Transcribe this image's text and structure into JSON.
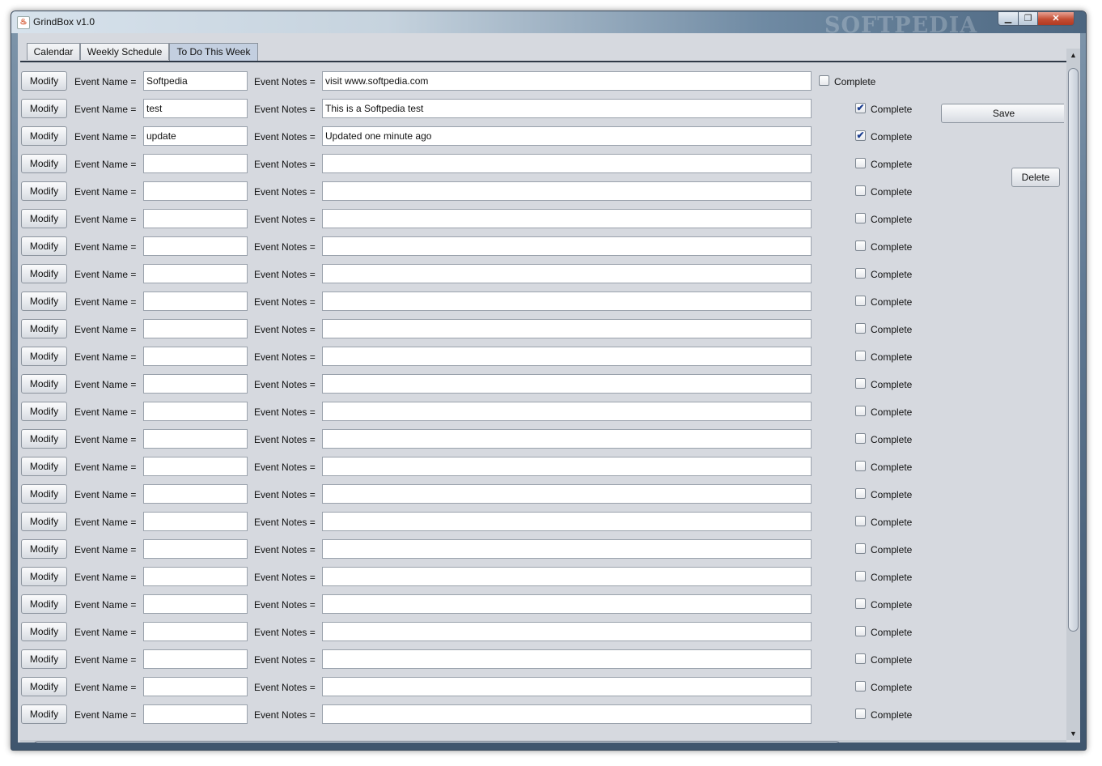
{
  "window": {
    "title": "GrindBox v1.0",
    "watermark": "SOFTPEDIA",
    "controls": {
      "minimize": "▁",
      "maximize": "❐",
      "close": "✕"
    }
  },
  "tabs": [
    {
      "label": "Calendar",
      "active": false
    },
    {
      "label": "Weekly Schedule",
      "active": false
    },
    {
      "label": "To Do This Week",
      "active": true
    }
  ],
  "labels": {
    "modify": "Modify",
    "event_name": "Event Name =",
    "event_notes": "Event Notes =",
    "complete": "Complete"
  },
  "actions": {
    "save": "Save",
    "delete": "Delete"
  },
  "rows": [
    {
      "name": "Softpedia",
      "notes": "visit www.softpedia.com",
      "complete": false
    },
    {
      "name": "test",
      "notes": "This is a Softpedia test",
      "complete": true
    },
    {
      "name": "update",
      "notes": "Updated one minute ago",
      "complete": true
    },
    {
      "name": "",
      "notes": "",
      "complete": false
    },
    {
      "name": "",
      "notes": "",
      "complete": false
    },
    {
      "name": "",
      "notes": "",
      "complete": false
    },
    {
      "name": "",
      "notes": "",
      "complete": false
    },
    {
      "name": "",
      "notes": "",
      "complete": false
    },
    {
      "name": "",
      "notes": "",
      "complete": false
    },
    {
      "name": "",
      "notes": "",
      "complete": false
    },
    {
      "name": "",
      "notes": "",
      "complete": false
    },
    {
      "name": "",
      "notes": "",
      "complete": false
    },
    {
      "name": "",
      "notes": "",
      "complete": false
    },
    {
      "name": "",
      "notes": "",
      "complete": false
    },
    {
      "name": "",
      "notes": "",
      "complete": false
    },
    {
      "name": "",
      "notes": "",
      "complete": false
    },
    {
      "name": "",
      "notes": "",
      "complete": false
    },
    {
      "name": "",
      "notes": "",
      "complete": false
    },
    {
      "name": "",
      "notes": "",
      "complete": false
    },
    {
      "name": "",
      "notes": "",
      "complete": false
    },
    {
      "name": "",
      "notes": "",
      "complete": false
    },
    {
      "name": "",
      "notes": "",
      "complete": false
    },
    {
      "name": "",
      "notes": "",
      "complete": false
    },
    {
      "name": "",
      "notes": "",
      "complete": false
    }
  ],
  "scrollbars": {
    "up": "▲",
    "down": "▼",
    "left": "◀",
    "right": "▶"
  },
  "icons": {
    "app": "java-cup-icon",
    "checkmark": "✔"
  }
}
